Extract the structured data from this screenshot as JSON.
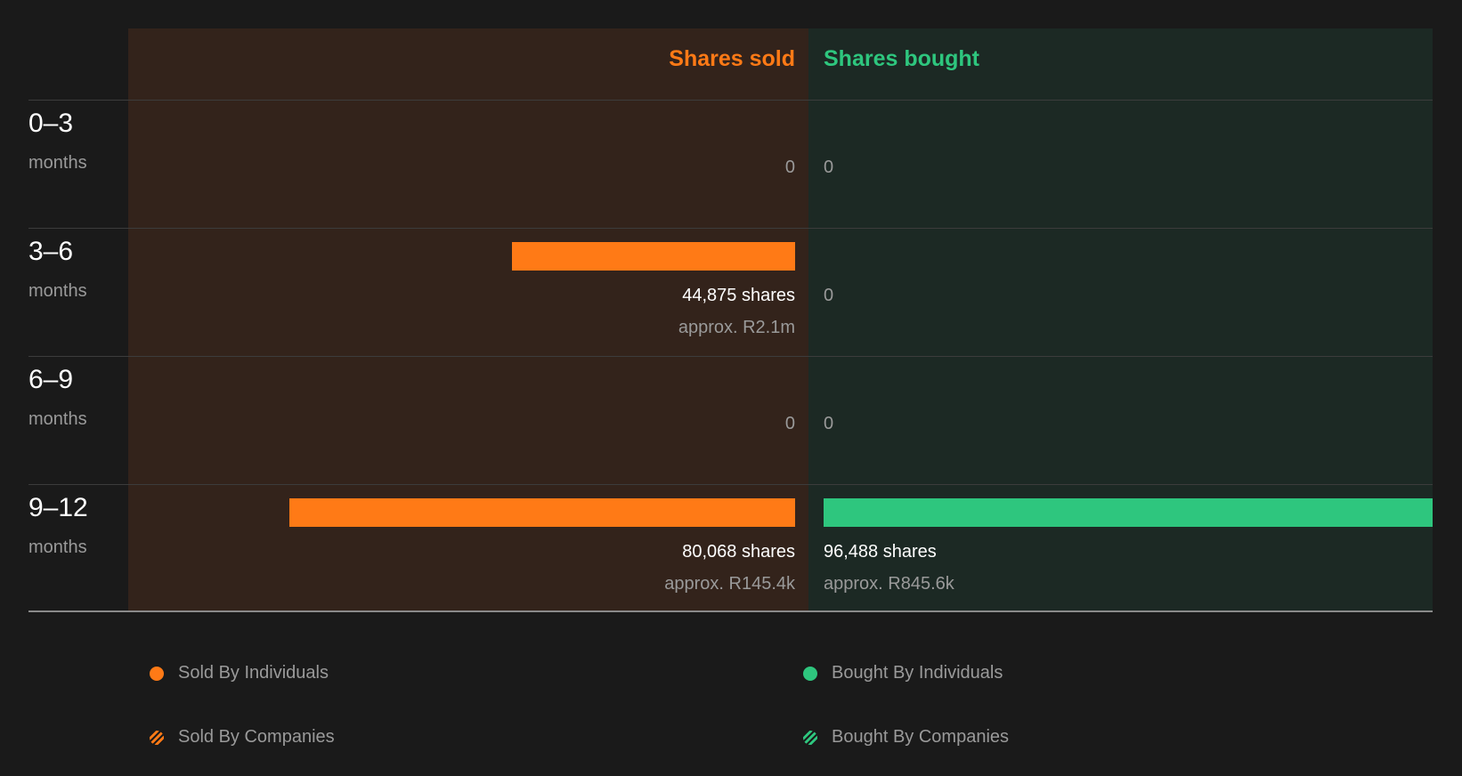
{
  "colors": {
    "sold": "#ff7a16",
    "bought": "#2ec67e"
  },
  "chart_data": {
    "type": "bar",
    "orientation": "horizontal-diverging",
    "left_header": "Shares sold",
    "right_header": "Shares bought",
    "categories": [
      {
        "label": "0–3",
        "unit": "months",
        "sold": 0,
        "bought": 0,
        "sold_text": "0",
        "bought_text": "0"
      },
      {
        "label": "3–6",
        "unit": "months",
        "sold": 44875,
        "bought": 0,
        "sold_text": "44,875 shares",
        "sold_value": "approx. R2.1m",
        "bought_text": "0"
      },
      {
        "label": "6–9",
        "unit": "months",
        "sold": 0,
        "bought": 0,
        "sold_text": "0",
        "bought_text": "0"
      },
      {
        "label": "9–12",
        "unit": "months",
        "sold": 80068,
        "bought": 96488,
        "sold_text": "80,068 shares",
        "sold_value": "approx. R145.4k",
        "bought_text": "96,488 shares",
        "bought_value": "approx. R845.6k"
      }
    ],
    "legend": [
      {
        "label": "Sold By Individuals",
        "icon": "solid-dot",
        "color": "#ff7a16"
      },
      {
        "label": "Bought By Individuals",
        "icon": "solid-dot",
        "color": "#2ec67e"
      },
      {
        "label": "Sold By Companies",
        "icon": "striped-dot",
        "color": "#ff7a16"
      },
      {
        "label": "Bought By Companies",
        "icon": "striped-dot",
        "color": "#2ec67e"
      }
    ]
  }
}
